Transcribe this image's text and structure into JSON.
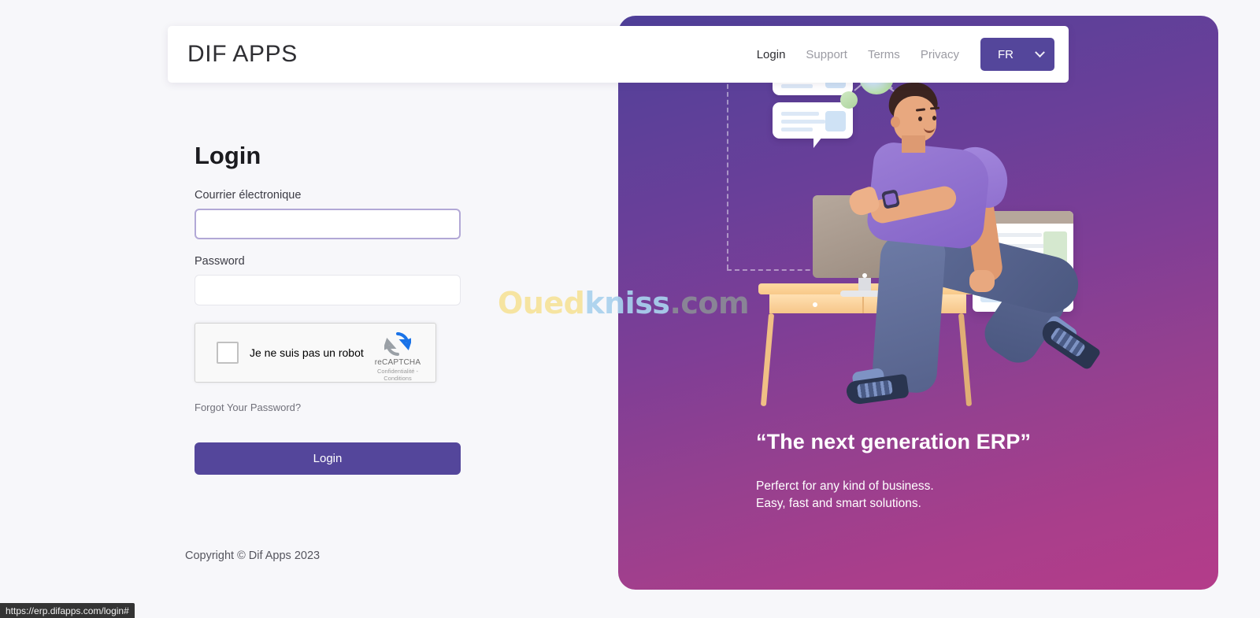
{
  "header": {
    "brand": "DIF APPS",
    "nav": [
      {
        "label": "Login",
        "active": true
      },
      {
        "label": "Support",
        "active": false
      },
      {
        "label": "Terms",
        "active": false
      },
      {
        "label": "Privacy",
        "active": false
      }
    ],
    "language": {
      "value": "FR",
      "icon": "chevron-down-icon"
    }
  },
  "login": {
    "title": "Login",
    "email_label": "Courrier électronique",
    "email_value": "",
    "email_placeholder": "",
    "password_label": "Password",
    "password_value": "",
    "password_placeholder": "",
    "recaptcha": {
      "checkbox_label": "Je ne suis pas un robot",
      "brand": "reCAPTCHA",
      "legal": "Confidentialité - Conditions",
      "checked": false
    },
    "forgot_password": "Forgot Your Password?",
    "submit_label": "Login"
  },
  "footer": {
    "copyright": "Copyright © Dif Apps 2023"
  },
  "hero": {
    "quote": "“The next generation ERP”",
    "line1": "Perferct for any kind of business.",
    "line2": "Easy, fast and smart solutions."
  },
  "watermark": {
    "part1": "Oued",
    "part2": "kniss",
    "part3": ".com"
  },
  "statusbar": {
    "url": "https://erp.difapps.com/login#"
  },
  "colors": {
    "accent_purple": "#54469b",
    "hero_gradient_start": "#4e3f98",
    "hero_gradient_end": "#b43c8a",
    "focus_border": "#b2a8d6",
    "nav_muted": "#9b9ba3"
  }
}
